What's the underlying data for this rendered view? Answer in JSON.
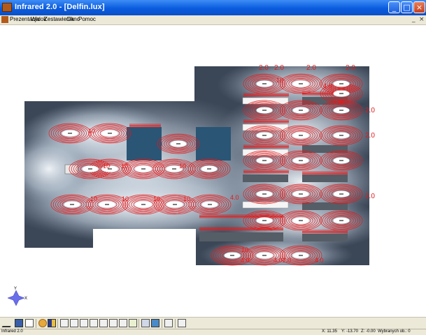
{
  "window": {
    "title": "Infrared 2.0 - [Delfin.lux]"
  },
  "menu": [
    "Prezentacja",
    "Widok",
    "Zestawienia",
    "Okno",
    "Pomoc"
  ],
  "mdi_controls": [
    "_",
    "×"
  ],
  "window_buttons": [
    "_",
    "□",
    "×"
  ],
  "axes": {
    "x": "X",
    "y": "Y"
  },
  "contour_labels": {
    "c2": "2.0",
    "c4": "4.0",
    "c10": "10",
    "c40": "4.0",
    "c402": "4.02.0"
  },
  "status": {
    "app": "Infrared 2.0",
    "x": "X: 11.35",
    "y": "Y: -13.70",
    "z": "Z: -0.00",
    "selected": "Wybranych ob.: 0"
  },
  "colors": {
    "contour": "#e31a1a",
    "floor": "#3b4656",
    "glow": "#eef3f8",
    "titlebar": "#0a5bde"
  }
}
